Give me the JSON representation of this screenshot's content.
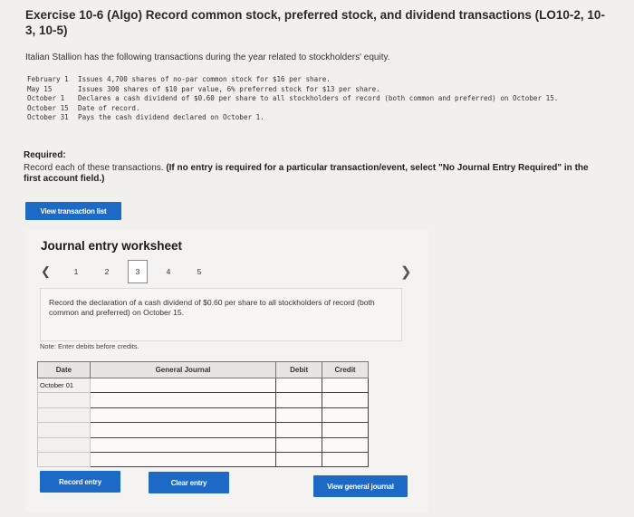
{
  "header": {
    "title": "Exercise 10-6 (Algo) Record common stock, preferred stock, and dividend transactions (LO10-2, 10-3, 10-5)"
  },
  "problem": {
    "intro": "Italian Stallion has the following transactions during the year related to stockholders' equity.",
    "transactions": [
      {
        "date": "February 1",
        "text": "Issues 4,700 shares of no-par common stock for $16 per share."
      },
      {
        "date": "May 15",
        "text": "Issues 300 shares of $10 par value, 6% preferred stock for $13 per share."
      },
      {
        "date": "October 1",
        "text": "Declares a cash dividend of $0.60 per share to all stockholders of record (both common and preferred) on October 15."
      },
      {
        "date": "October 15",
        "text": "Date of record."
      },
      {
        "date": "October 31",
        "text": "Pays the cash dividend declared on October 1."
      }
    ]
  },
  "required": {
    "heading": "Required:",
    "text": "Record each of these transactions.",
    "bold_note": "(If no entry is required for a particular transaction/event, select \"No Journal Entry Required\" in the first account field.)"
  },
  "buttons": {
    "view_transaction_list": "View transaction list",
    "record_entry": "Record entry",
    "clear_entry": "Clear entry",
    "view_general_journal": "View general journal"
  },
  "worksheet": {
    "title": "Journal entry worksheet",
    "pages": [
      "1",
      "2",
      "3",
      "4",
      "5"
    ],
    "active_page": "3",
    "prev_icon": "chevron-left-icon",
    "next_icon": "chevron-right-icon",
    "description": "Record the declaration of a cash dividend of $0.60 per share to all stockholders of record (both common and preferred) on October 15.",
    "note": "Note: Enter debits before credits.",
    "table": {
      "headers": {
        "date": "Date",
        "journal": "General Journal",
        "debit": "Debit",
        "credit": "Credit"
      },
      "rows": [
        {
          "date": "October 01"
        },
        {
          "date": ""
        },
        {
          "date": ""
        },
        {
          "date": ""
        },
        {
          "date": ""
        },
        {
          "date": ""
        }
      ]
    }
  },
  "colors": {
    "button_blue": "#1d69c6",
    "page_background": "#f2f0ed"
  }
}
